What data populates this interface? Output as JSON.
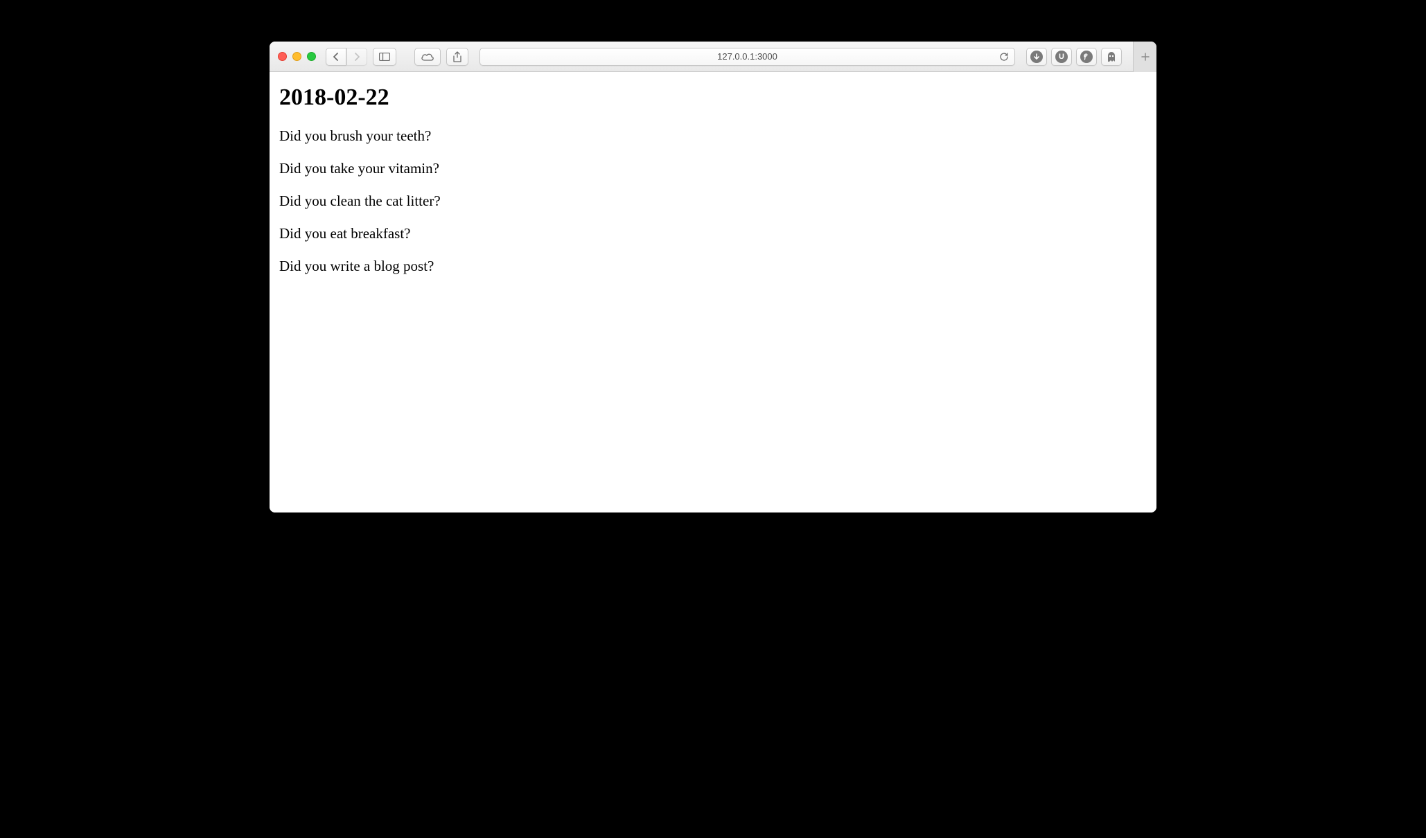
{
  "browser": {
    "url": "127.0.0.1:3000",
    "extensions": {
      "download_label": "↓",
      "ublock_label": "U",
      "pinterest_label": "P",
      "ghostery_label": "👻"
    }
  },
  "page": {
    "heading": "2018-02-22",
    "items": [
      "Did you brush your teeth?",
      "Did you take your vitamin?",
      "Did you clean the cat litter?",
      "Did you eat breakfast?",
      "Did you write a blog post?"
    ]
  }
}
